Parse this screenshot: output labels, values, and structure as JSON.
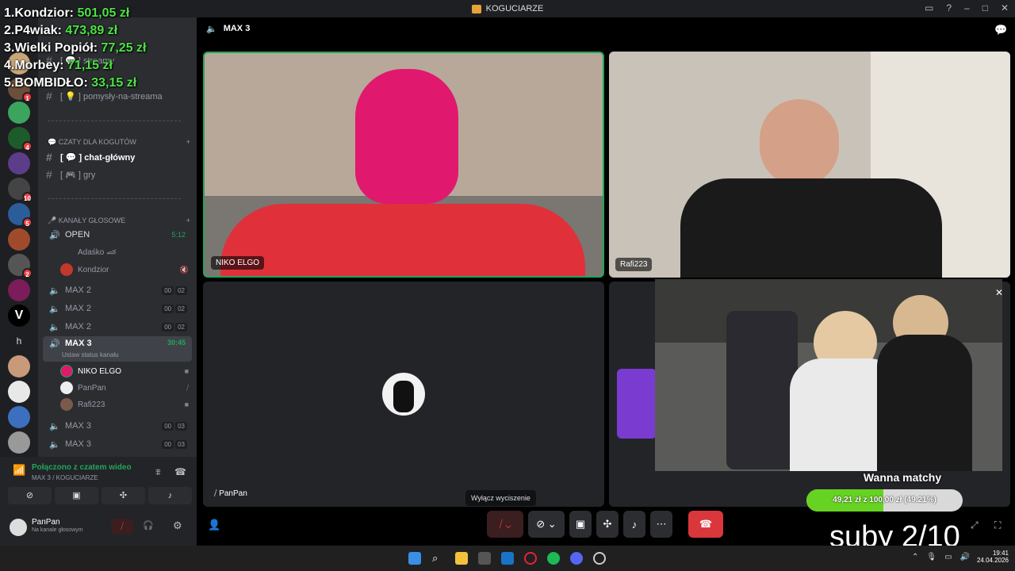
{
  "window": {
    "title": "KOGUCIARZE"
  },
  "leaderboard": [
    {
      "rank": "1.",
      "name": "Kondzior:",
      "amount": "501,05 zł"
    },
    {
      "rank": "2.",
      "name": "P4wiak:",
      "amount": "473,89 zł"
    },
    {
      "rank": "3.",
      "name": "Wielki Popiół:",
      "amount": "77,25 zł"
    },
    {
      "rank": "4.",
      "name": "Morbey:",
      "amount": "71,15 zł"
    },
    {
      "rank": "5.",
      "name": "BOMBIDŁO:",
      "amount": "33,15 zł"
    }
  ],
  "channels": {
    "top": [
      {
        "label": "[ 💬 ] streamy"
      },
      {
        "label": "[ 💡 ] pomysły-na-streama"
      }
    ],
    "cat_chats": "💬 CZATY DLA KOGUTÓW",
    "chats": [
      {
        "label": "[ 💬 ] chat-główny"
      },
      {
        "label": "[ 🎮 ] gry"
      }
    ],
    "cat_voice": "🎤 KANAŁY GŁOSOWE",
    "open": {
      "label": "OPEN",
      "time": "5:12"
    },
    "open_members": [
      {
        "name": "Adaśko 🏎"
      },
      {
        "name": "Kondzior"
      }
    ],
    "max2": [
      {
        "label": "MAX 2",
        "a": "00",
        "b": "02"
      },
      {
        "label": "MAX 2",
        "a": "00",
        "b": "02"
      },
      {
        "label": "MAX 2",
        "a": "00",
        "b": "02"
      }
    ],
    "max3": {
      "label": "MAX 3",
      "time": "30:45",
      "status": "Ustaw status kanału"
    },
    "max3_members": [
      {
        "name": "NIKO ELGO"
      },
      {
        "name": "PanPan"
      },
      {
        "name": "Rafi223"
      }
    ],
    "max3_more": [
      {
        "label": "MAX 3",
        "a": "00",
        "b": "03"
      },
      {
        "label": "MAX 3",
        "a": "00",
        "b": "03"
      }
    ]
  },
  "voice": {
    "status": "Połączono z czatem wideo",
    "channel": "MAX 3 / KOGUCIARZE"
  },
  "user": {
    "name": "PanPan",
    "status": "Na kanale głosowym"
  },
  "stage": {
    "channel": "MAX 3",
    "tiles": [
      {
        "name": "NIKO ELGO"
      },
      {
        "name": "Rafi223"
      },
      {
        "name": "PanPan"
      }
    ]
  },
  "tooltip": "Wyłącz wyciszenie",
  "goal": {
    "title": "Wanna matchy",
    "text": "49,21 zł z 100,00 zł (49.21%)",
    "progress": 0.4921
  },
  "subs": "suby 2/10",
  "clock": {
    "time": "19:41",
    "date": "24.04.2026"
  },
  "icons": [
    "speaker-icon",
    "hash-icon",
    "mic-muted-icon",
    "camera-icon",
    "screen-share-icon",
    "activities-icon",
    "soundboard-icon",
    "more-icon",
    "hangup-icon",
    "settings-icon",
    "headphones-icon"
  ],
  "colors": {
    "accent": "#23a55a",
    "danger": "#da373c",
    "pink": "#e0186e",
    "goal": "#66d322"
  }
}
